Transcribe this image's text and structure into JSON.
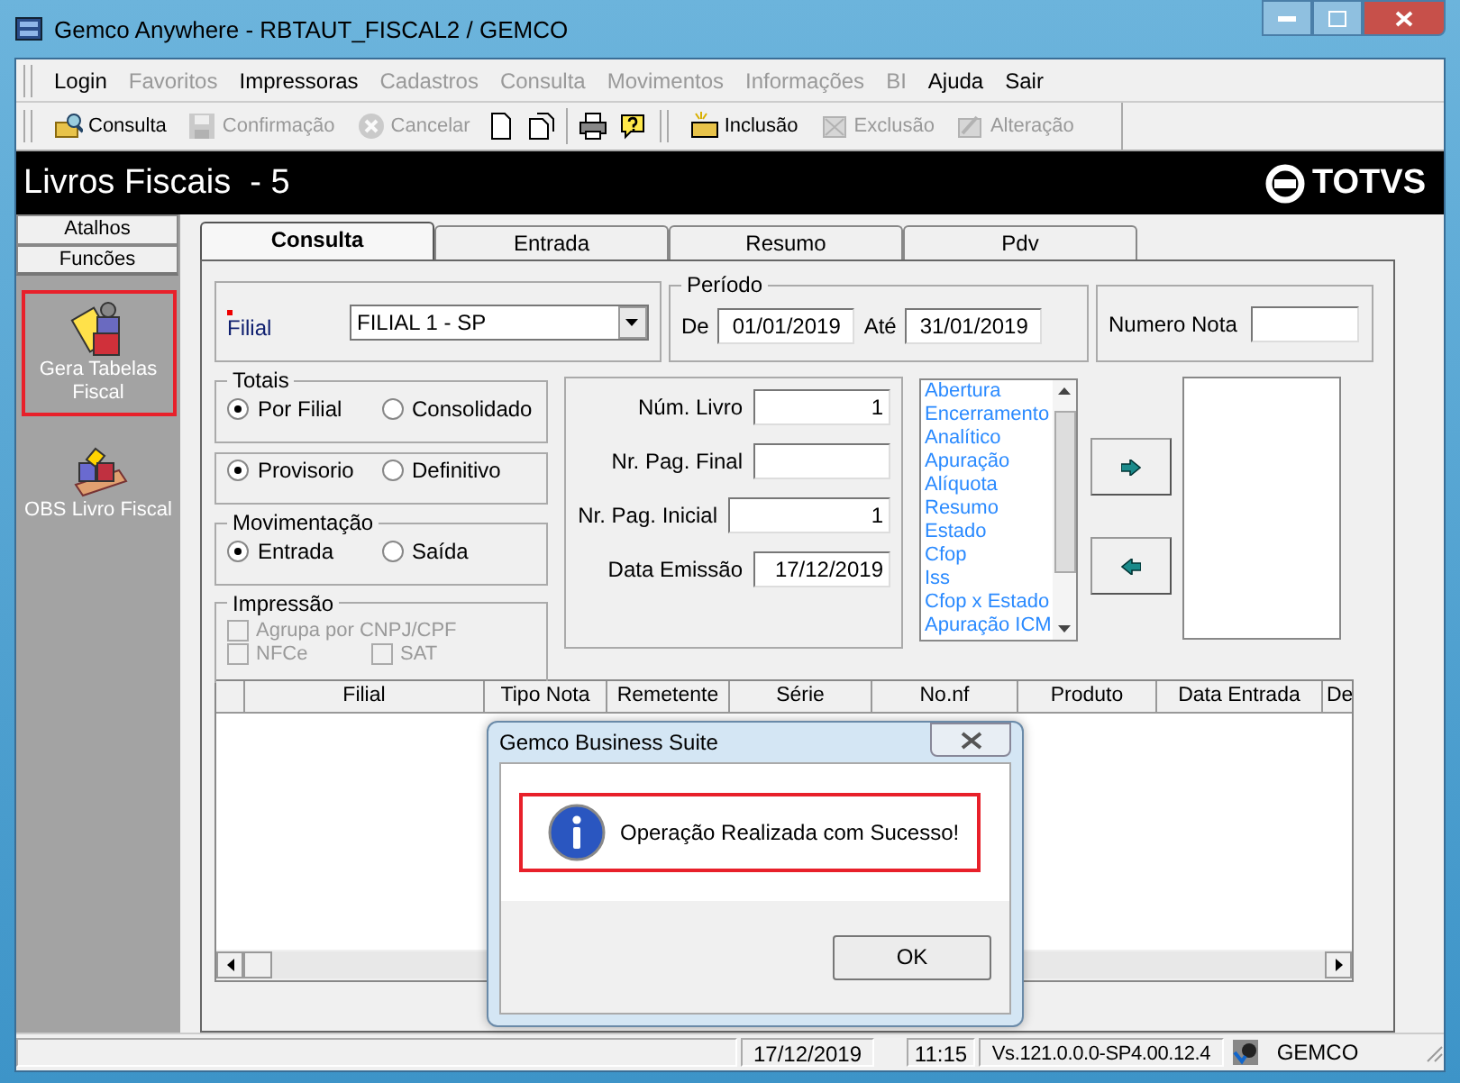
{
  "window": {
    "title": "Gemco Anywhere - RBTAUT_FISCAL2 / GEMCO"
  },
  "menu": [
    {
      "label": "Login",
      "disabled": false
    },
    {
      "label": "Favoritos",
      "disabled": true
    },
    {
      "label": "Impressoras",
      "disabled": false
    },
    {
      "label": "Cadastros",
      "disabled": true
    },
    {
      "label": "Consulta",
      "disabled": true
    },
    {
      "label": "Movimentos",
      "disabled": true
    },
    {
      "label": "Informações",
      "disabled": true
    },
    {
      "label": "BI",
      "disabled": true
    },
    {
      "label": "Ajuda",
      "disabled": false
    },
    {
      "label": "Sair",
      "disabled": false
    }
  ],
  "toolbar": [
    [
      {
        "kind": "text",
        "label": "Consulta",
        "disabled": false
      },
      {
        "kind": "text",
        "label": "Confirmação",
        "disabled": true
      },
      {
        "kind": "text",
        "label": "Cancelar",
        "disabled": true
      },
      {
        "kind": "icon"
      },
      {
        "kind": "icon"
      }
    ],
    [
      {
        "kind": "icon"
      },
      {
        "kind": "icon"
      }
    ],
    [
      {
        "kind": "text",
        "label": "Inclusão",
        "disabled": false
      },
      {
        "kind": "text",
        "label": "Exclusão",
        "disabled": true
      },
      {
        "kind": "text",
        "label": "Alteração",
        "disabled": true
      }
    ]
  ],
  "header": {
    "title": "Livros Fiscais  - 5",
    "logo": "TOTVS"
  },
  "sidebar": {
    "tabs": [
      {
        "label": "Atalhos",
        "selected": false
      },
      {
        "label": "Funcões",
        "selected": true
      }
    ],
    "items": [
      {
        "label": "Gera Tabelas Fiscal",
        "highlighted": true
      },
      {
        "label": "OBS Livro Fiscal",
        "highlighted": false
      }
    ]
  },
  "tabs": [
    {
      "label": "Consulta",
      "selected": true
    },
    {
      "label": "Entrada",
      "selected": false
    },
    {
      "label": "Resumo",
      "selected": false
    },
    {
      "label": "Pdv",
      "selected": false
    }
  ],
  "filial": {
    "label": "Filial",
    "required": true,
    "value": "FILIAL 1 - SP"
  },
  "periodo": {
    "title": "Período",
    "from_label": "De",
    "from": "01/01/2019",
    "to_label": "Até",
    "to": "31/01/2019"
  },
  "numero_nota": {
    "label": "Numero Nota"
  },
  "totais": {
    "title": "Totais",
    "options": [
      {
        "label": "Por Filial",
        "selected": true
      },
      {
        "label": "Consolidado",
        "selected": false
      }
    ]
  },
  "tipo": {
    "options": [
      {
        "label": "Provisorio",
        "selected": true
      },
      {
        "label": "Definitivo",
        "selected": false
      }
    ]
  },
  "movimentacao": {
    "title": "Movimentação",
    "options": [
      {
        "label": "Entrada",
        "selected": true
      },
      {
        "label": "Saída",
        "selected": false
      }
    ]
  },
  "impressao": {
    "title": "Impressão",
    "options": [
      {
        "label": "Agrupa por CNPJ/CPF",
        "checked": false,
        "disabled": true
      },
      {
        "label": "NFCe",
        "checked": false,
        "disabled": true
      },
      {
        "label": "SAT",
        "checked": false,
        "disabled": true
      }
    ]
  },
  "livro_fields": [
    {
      "label": "Núm. Livro",
      "value": "1"
    },
    {
      "label": "Nr. Pag. Final"
    },
    {
      "label": "Nr. Pag. Inicial",
      "value": "1"
    },
    {
      "label": "Data Emissão",
      "value": "17/12/2019"
    }
  ],
  "reports": [
    "Abertura",
    "Encerramento",
    "Analítico",
    "Apuração",
    "Alíquota",
    "Resumo",
    "Estado",
    "Cfop",
    "Iss",
    "Cfop x Estado",
    "Apuração ICM"
  ],
  "table": {
    "columns": [
      "Filial",
      "Tipo Nota",
      "Remetente",
      "Série",
      "No.nf",
      "Produto",
      "Data Entrada",
      "De"
    ]
  },
  "dialog": {
    "title": "Gemco Business Suite",
    "message": "Operação Realizada com Sucesso!",
    "button": "OK",
    "highlighted": true
  },
  "status_bar": {
    "date": "17/12/2019",
    "time": "11:15",
    "version": "Vs.121.0.0.0-SP4.00.12.4",
    "user": "GEMCO"
  }
}
